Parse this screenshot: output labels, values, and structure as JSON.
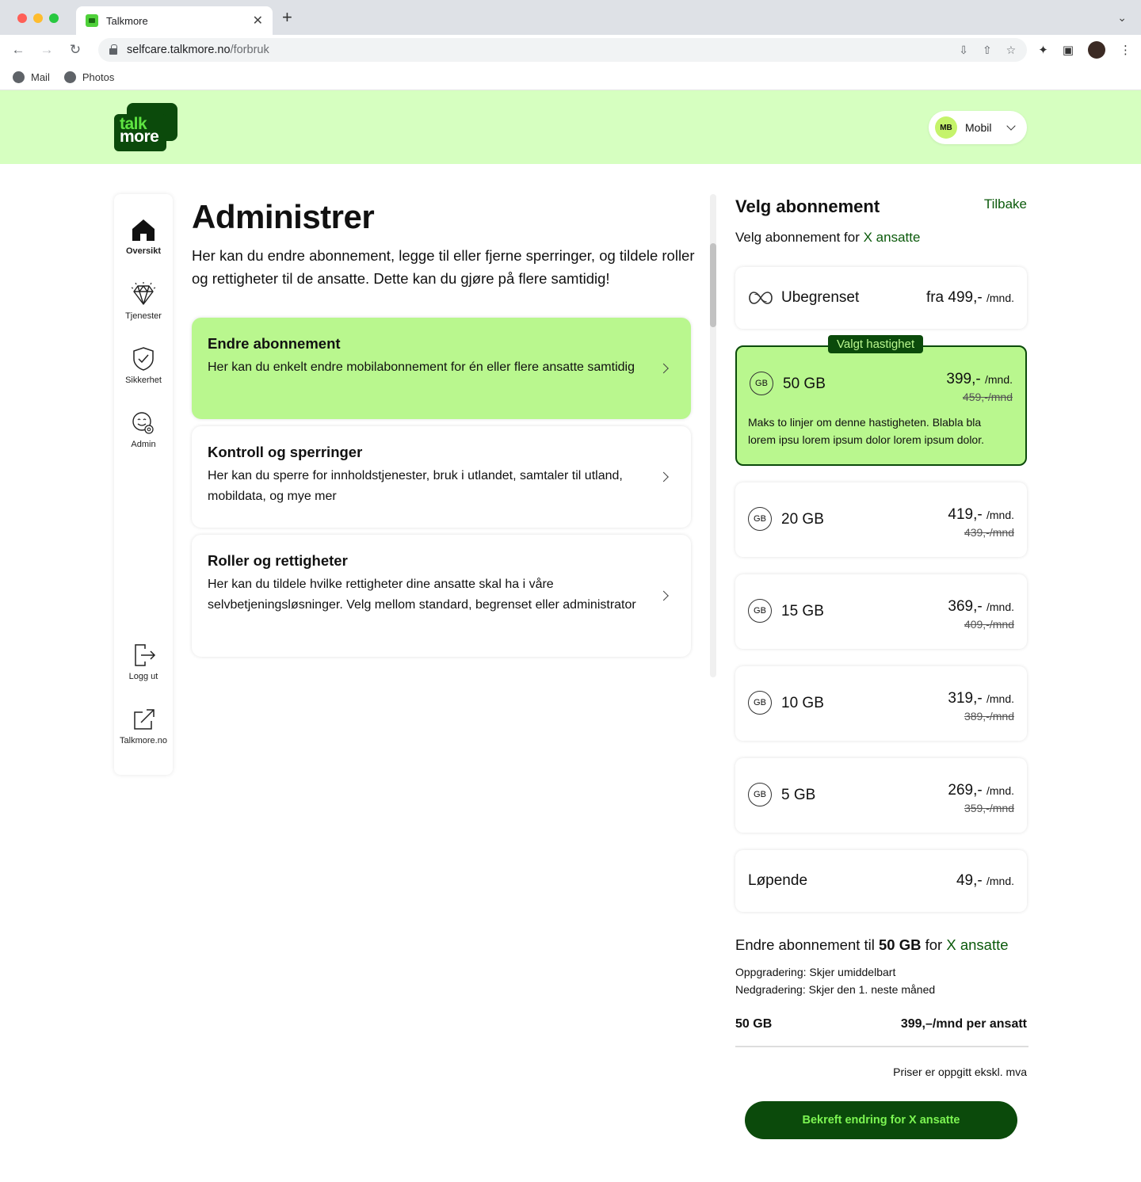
{
  "browser": {
    "tab_title": "Talkmore",
    "url_domain": "selfcare.talkmore.no",
    "url_path": "/forbruk",
    "bookmarks": [
      {
        "label": "Mail"
      },
      {
        "label": "Photos"
      }
    ]
  },
  "header": {
    "logo_talk": "talk",
    "logo_more": "more",
    "account_initials": "MB",
    "account_label": "Mobil"
  },
  "sidebar": {
    "items": [
      {
        "label": "Oversikt",
        "icon": "home-icon"
      },
      {
        "label": "Tjenester",
        "icon": "diamond-icon"
      },
      {
        "label": "Sikkerhet",
        "icon": "shield-check-icon"
      },
      {
        "label": "Admin",
        "icon": "admin-face-gear-icon"
      },
      {
        "label": "Logg ut",
        "icon": "logout-icon"
      },
      {
        "label": "Talkmore.no",
        "icon": "external-link-icon"
      }
    ]
  },
  "main": {
    "title": "Administrer",
    "intro": "Her kan du endre abonnement, legge til eller fjerne sperringer, og tildele roller og rettigheter til de ansatte. Dette kan du gjøre på flere samtidig!",
    "cards": [
      {
        "title": "Endre abonnement",
        "text": "Her kan du enkelt endre mobilabonnement for én eller flere ansatte samtidig"
      },
      {
        "title": "Kontroll og sperringer",
        "text": "Her kan du sperre for innholdstjenester, bruk i utlandet, samtaler til utland, mobildata, og mye mer"
      },
      {
        "title": "Roller og rettigheter",
        "text": "Her kan du tildele hvilke rettigheter dine ansatte skal ha i våre selvbetjeningsløsninger. Velg mellom standard, begrenset eller administrator"
      }
    ]
  },
  "plans_panel": {
    "title": "Velg abonnement",
    "back_label": "Tilbake",
    "subtitle_prefix": "Velg abonnement for ",
    "subtitle_accent": "X ansatte",
    "selected_badge": "Valgt hastighet",
    "gb_icon_text": "GB",
    "plans": [
      {
        "name": "Ubegrenset",
        "price": "fra 499,-",
        "unit": "/mnd.",
        "icon": "infinity-icon"
      },
      {
        "name": "50 GB",
        "price": "399,-",
        "unit": "/mnd.",
        "old_price": "459,-/mnd",
        "description": "Maks to linjer om denne hastigheten. Blabla bla lorem ipsu lorem ipsum dolor lorem ipsum dolor.",
        "selected": true
      },
      {
        "name": "20 GB",
        "price": "419,-",
        "unit": "/mnd.",
        "old_price": "439,-/mnd"
      },
      {
        "name": "15 GB",
        "price": "369,-",
        "unit": "/mnd.",
        "old_price": "409,-/mnd"
      },
      {
        "name": "10 GB",
        "price": "319,-",
        "unit": "/mnd.",
        "old_price": "389,-/mnd"
      },
      {
        "name": "5 GB",
        "price": "269,-",
        "unit": "/mnd.",
        "old_price": "359,-/mnd"
      },
      {
        "name": "Løpende",
        "price": "49,-",
        "unit": "/mnd."
      }
    ]
  },
  "summary": {
    "title_prefix": "Endre abonnement til ",
    "title_plan": "50 GB",
    "title_mid": " for ",
    "title_accent": "X ansatte",
    "upgrade_note": "Oppgradering: Skjer umiddelbart",
    "downgrade_note": "Nedgradering: Skjer den 1. neste måned",
    "total_plan": "50 GB",
    "total_price": "399,–/mnd per ansatt",
    "vat_note": "Priser er oppgitt ekskl. mva",
    "confirm_label": "Bekreft endring for X ansatte"
  },
  "colors": {
    "header_bg": "#d6ffc0",
    "brand_dark": "#0b4a0b",
    "active_card": "#b9f78e"
  }
}
